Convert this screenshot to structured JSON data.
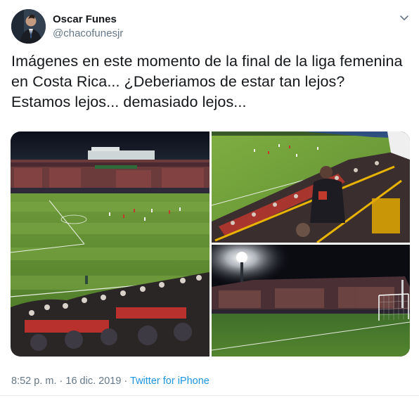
{
  "user": {
    "name": "Oscar Funes",
    "handle": "@chacofunesjr"
  },
  "tweet": {
    "text": "Imágenes en este momento de la final de la liga femenina en Costa Rica... ¿Deberiamos de estar tan lejos? Estamos lejos... demasiado lejos..."
  },
  "meta": {
    "time": "8:52 p. m.",
    "separator1": " · ",
    "date": "16 dic. 2019",
    "separator2": " · ",
    "source": "Twitter for iPhone"
  },
  "icons": {
    "menu": "chevron-down-icon"
  },
  "colors": {
    "link": "#1b95e0",
    "secondary_text": "#657786",
    "primary_text": "#14171a"
  }
}
